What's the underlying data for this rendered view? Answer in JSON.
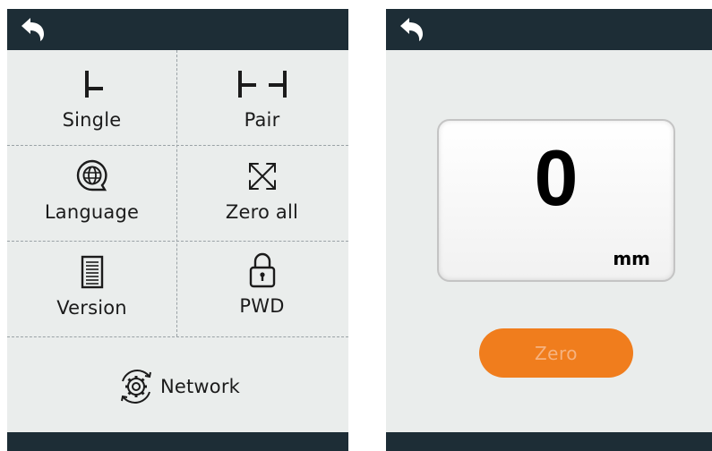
{
  "left_screen": {
    "menu": [
      {
        "label": "Single",
        "icon": "single-probe-icon"
      },
      {
        "label": "Pair",
        "icon": "pair-probe-icon"
      },
      {
        "label": "Language",
        "icon": "globe-chat-icon"
      },
      {
        "label": "Zero all",
        "icon": "expand-arrows-icon"
      },
      {
        "label": "Version",
        "icon": "document-icon"
      },
      {
        "label": "PWD",
        "icon": "padlock-icon"
      }
    ],
    "network": {
      "label": "Network",
      "icon": "gear-sync-icon"
    }
  },
  "right_screen": {
    "reading": {
      "value": "0",
      "unit": "mm"
    },
    "zero_button": {
      "label": "Zero",
      "color": "#f07d1d"
    }
  },
  "colors": {
    "topbar": "#1d2d36",
    "screen_bg": "#eaedec",
    "accent": "#f07d1d"
  }
}
